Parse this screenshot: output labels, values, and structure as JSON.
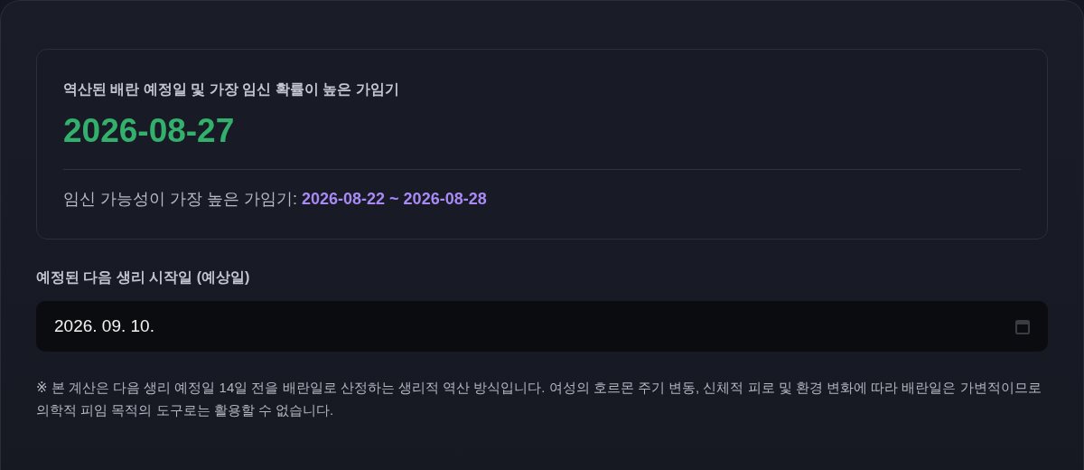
{
  "result_card": {
    "title": "역산된 배란 예정일 및 가장 임신 확률이 높은 가임기",
    "ovulation_date": "2026-08-27",
    "fertile_window": "임신 가능성이 가장 높은 가임기: **2026-08-22 ~ 2026-08-28**"
  },
  "next_period": {
    "label": "예정된 다음 생리 시작일 (예상일)",
    "value": "2026. 09. 10."
  },
  "note": "※ 본 계산은 다음 생리 예정일 14일 전을 배란일로 산정하는 생리적 역산 방식입니다. 여성의 호르몬 주기 변동, 신체적 피로 및 환경 변화에 따라 배란일은 가변적이므로 의학적 피임 목적의 도구로는 활용할 수 없습니다."
}
